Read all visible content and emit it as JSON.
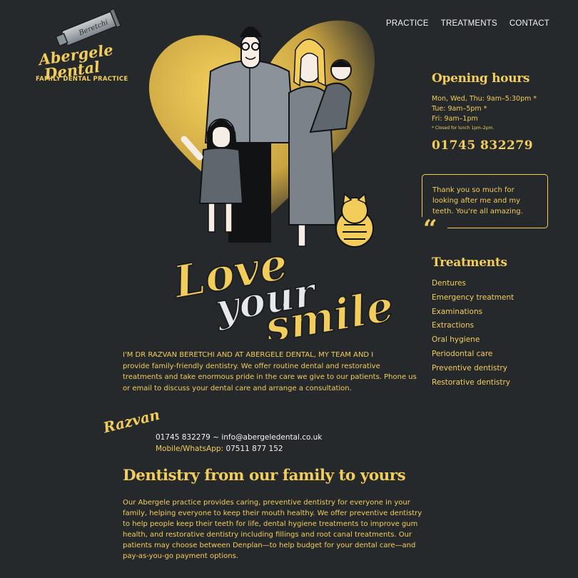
{
  "logo": {
    "tube_text": "Beretchi",
    "line1": "Abergele",
    "line2": "Dental",
    "tagline": "FAMILY DENTAL PRACTICE"
  },
  "nav": {
    "items": [
      {
        "label": "PRACTICE"
      },
      {
        "label": "TREATMENTS"
      },
      {
        "label": "CONTACT"
      }
    ]
  },
  "slogan": {
    "word1": "Love",
    "word2": "your",
    "word3": "smile"
  },
  "opening_hours": {
    "title": "Opening hours",
    "lines": [
      "Mon, Wed, Thu: 9am–5:30pm *",
      "Tue: 9am–5pm *",
      "Fri: 9am–1pm"
    ],
    "note": "* Closed for lunch 1pm–2pm.",
    "phone": "01745 832279"
  },
  "testimonial": {
    "text": "Thank you so much for looking after me and my teeth. You're all amazing.",
    "mark": "“"
  },
  "treatments": {
    "title": "Treatments",
    "items": [
      {
        "label": "Dentures"
      },
      {
        "label": "Emergency treatment"
      },
      {
        "label": "Examinations"
      },
      {
        "label": "Extractions"
      },
      {
        "label": "Oral hygiene"
      },
      {
        "label": "Periodontal care"
      },
      {
        "label": "Preventive dentistry"
      },
      {
        "label": "Restorative dentistry"
      }
    ]
  },
  "intro": {
    "lead": "I'M DR RAZVAN BERETCHI AND AT ABERGELE DENTAL, MY TEAM AND I",
    "rest": "provide family-friendly dentistry. We offer routine dental and restorative treatments and take enormous pride in the care we give to our patients. Phone us or email to discuss your dental care and arrange a consultation."
  },
  "signature": "Razvan",
  "contact": {
    "phone": "01745 832279",
    "separator": " ~ ",
    "email": "info@abergeledental.co.uk",
    "mobile_label": "Mobile/WhatsApp: ",
    "mobile": "07511 877 152"
  },
  "section": {
    "heading": "Dentistry from our family to yours",
    "body": "Our Abergele practice provides caring, preventive dentistry for everyone in your family, helping everyone to keep their mouth healthy. We offer preventive dentistry to help people keep their teeth for life, dental hygiene treatments to improve gum health, and restorative dentistry including fillings and root canal treatments. Our patients may choose between Denplan—to help budget for your dental care—and pay-as-you-go payment options."
  },
  "colors": {
    "background": "#26292c",
    "accent": "#f2cd5c",
    "text_light": "#f3f3f3"
  }
}
